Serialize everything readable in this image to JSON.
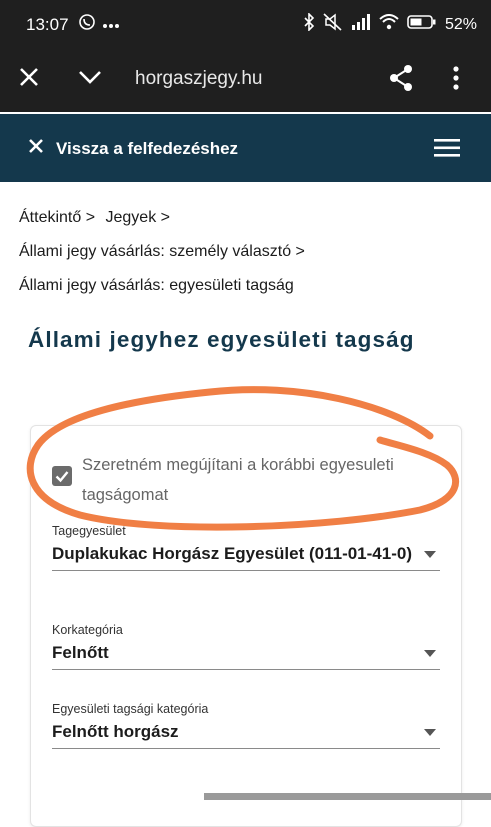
{
  "statusbar": {
    "time": "13:07",
    "battery": "52",
    "icons": [
      "viber-icon",
      "more-dots-icon",
      "bluetooth-icon",
      "mute-icon",
      "signal-icon",
      "wifi-icon",
      "battery-icon"
    ]
  },
  "browser": {
    "url": "horgaszjegy.hu",
    "icons": [
      "close-icon",
      "chevron-down-icon",
      "share-icon",
      "more-vert-icon"
    ]
  },
  "sitenav": {
    "back_label": "Vissza a felfedezéshez",
    "icons": [
      "close-icon",
      "hamburger-menu-icon"
    ]
  },
  "breadcrumb": {
    "items": [
      "Áttekintő >",
      "Jegyek >",
      "Állami jegy vásárlás: személy választó >",
      "Állami jegy vásárlás: egyesületi tagság"
    ]
  },
  "page": {
    "title": "Állami jegyhez egyesületi tagság"
  },
  "form": {
    "renew_checkbox": {
      "label": "Szeretném megújítani a korábbi egyesuleti tagságomat",
      "checked": true
    },
    "club": {
      "label": "Tagegyesület",
      "value": "Duplakukac Horgász Egyesület (011-01-41-0)"
    },
    "age_category": {
      "label": "Korkategória",
      "value": "Felnőtt"
    },
    "membership_category": {
      "label": "Egyesületi tagsági kategória",
      "value": "Felnőtt horgász"
    }
  },
  "colors": {
    "nav_bg": "#14384c",
    "title": "#14384c",
    "annotation": "#f07f45",
    "browser_bg": "#1f1f1f"
  }
}
